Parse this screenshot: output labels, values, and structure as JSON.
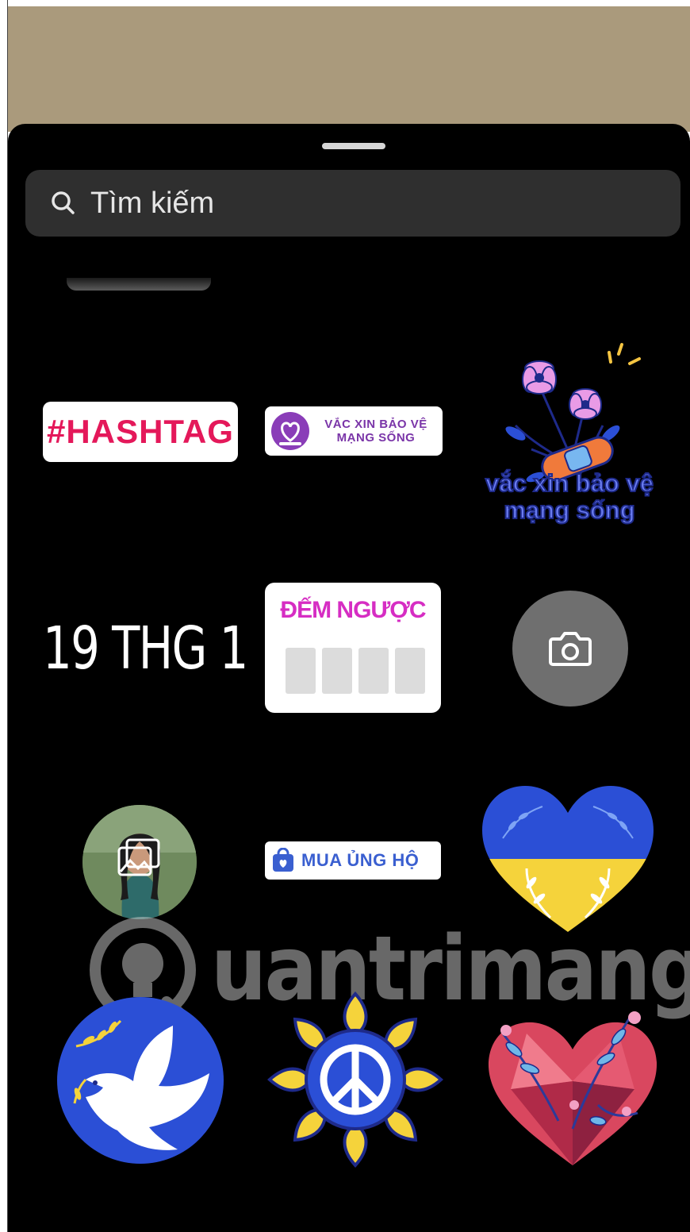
{
  "search": {
    "placeholder": "Tìm kiếm"
  },
  "stickers": {
    "hashtag": "#HASHTAG",
    "vaccine_badge": "VẮC XIN BẢO VỆ MẠNG SỐNG",
    "vaccine_caption_line1": "vắc xin bảo vệ",
    "vaccine_caption_line2": "mạng sống",
    "date": "19 THG 1",
    "countdown_title": "ĐẾM NGƯỢC",
    "shop_label": "MUA ỦNG HỘ"
  },
  "watermark": {
    "text": "uantrimang"
  },
  "colors": {
    "sheet_bg": "#000000",
    "photo_strip": "#aa9a7c",
    "hashtag": "#e4185a",
    "countdown": "#d62dc3",
    "ukraine_blue": "#2b4fd6",
    "ukraine_yellow": "#f5d33b"
  },
  "icons": [
    "search-icon",
    "camera-icon",
    "shopping-bag-icon",
    "vaccine-heart-icon",
    "gallery-icon"
  ]
}
